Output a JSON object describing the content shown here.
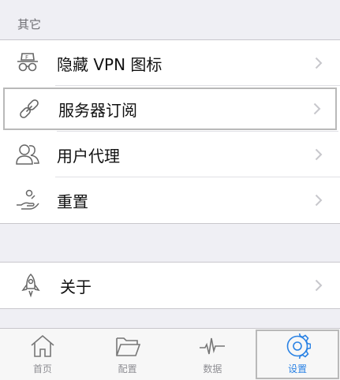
{
  "section": {
    "title": "其它"
  },
  "other_items": [
    {
      "label": "隐藏 VPN 图标",
      "icon": "incognito-icon"
    },
    {
      "label": "服务器订阅",
      "icon": "link-icon"
    },
    {
      "label": "用户代理",
      "icon": "users-icon"
    },
    {
      "label": "重置",
      "icon": "hand-reset-icon"
    }
  ],
  "about": {
    "label": "关于",
    "icon": "rocket-icon"
  },
  "tabs": [
    {
      "label": "首页",
      "icon": "home-icon",
      "active": false
    },
    {
      "label": "配置",
      "icon": "folder-icon",
      "active": false
    },
    {
      "label": "数据",
      "icon": "pulse-icon",
      "active": false
    },
    {
      "label": "设置",
      "icon": "gear-icon",
      "active": true
    }
  ],
  "colors": {
    "accent": "#2a82e4",
    "background": "#efeff4",
    "icon_gray": "#666666"
  }
}
